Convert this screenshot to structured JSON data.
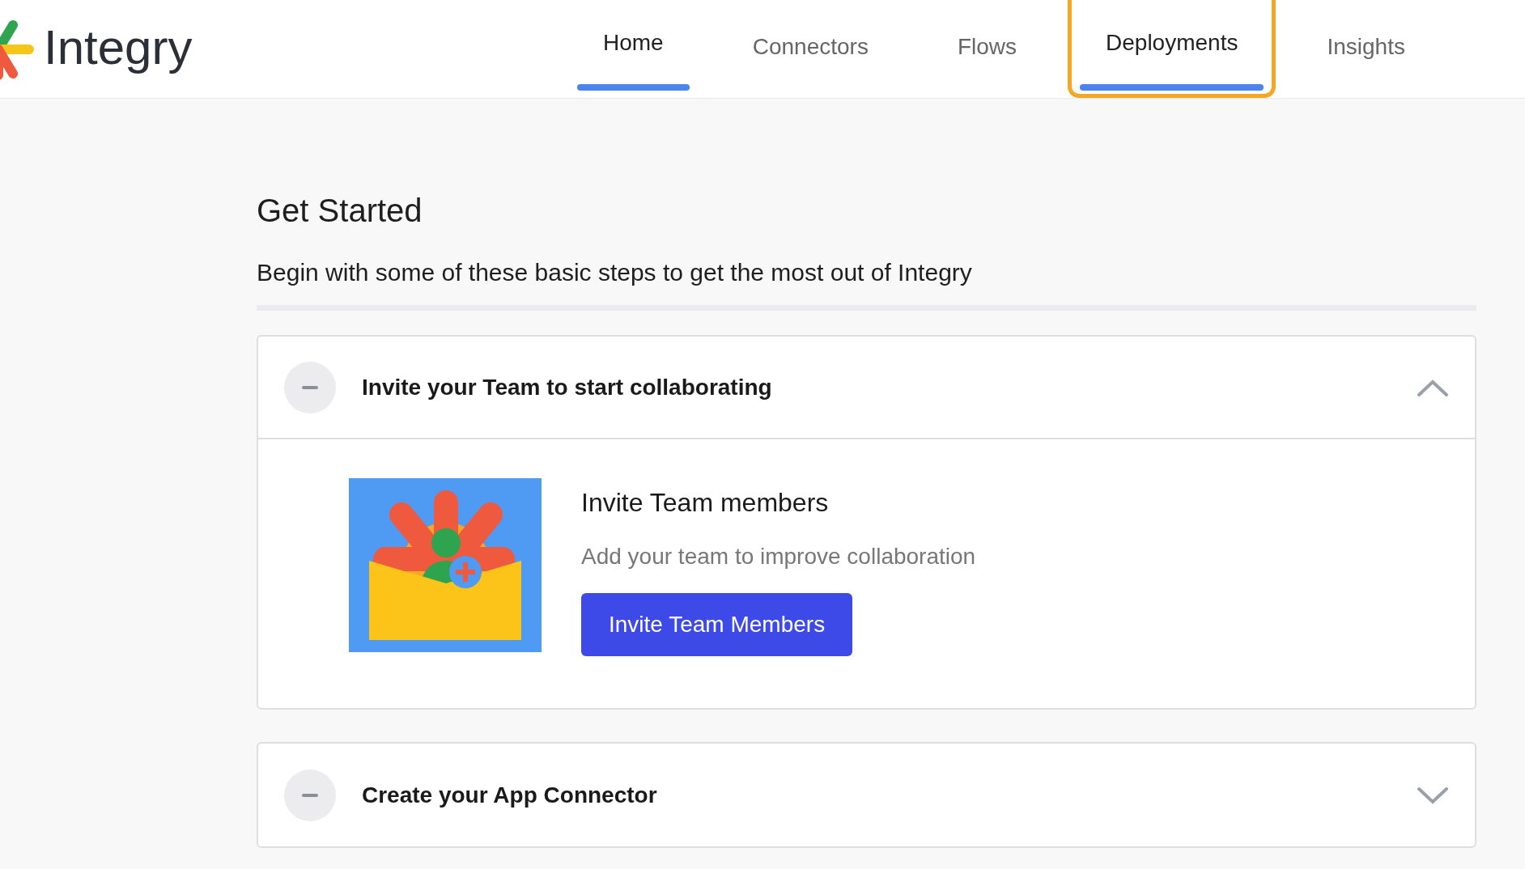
{
  "logo": {
    "text": "Integry"
  },
  "nav": [
    {
      "label": "Home",
      "selected": true,
      "highlighted": false
    },
    {
      "label": "Connectors",
      "selected": false,
      "highlighted": false
    },
    {
      "label": "Flows",
      "selected": false,
      "highlighted": false
    },
    {
      "label": "Deployments",
      "selected": true,
      "highlighted": true
    },
    {
      "label": "Insights",
      "selected": false,
      "highlighted": false
    }
  ],
  "heading": "Get Started",
  "subheading": "Begin with some of these basic steps to get the most out of Integry",
  "steps": [
    {
      "title": "Invite your Team to start collaborating",
      "expanded": true,
      "content": {
        "title": "Invite Team members",
        "description": "Add your team to improve collaboration",
        "button": "Invite Team Members"
      }
    },
    {
      "title": "Create your App Connector",
      "expanded": false
    }
  ]
}
